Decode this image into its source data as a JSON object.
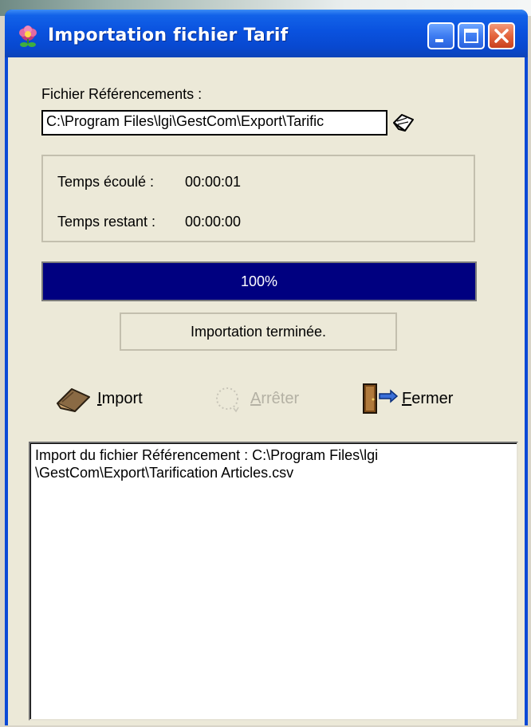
{
  "window": {
    "title": "Importation fichier Tarif"
  },
  "icons": {
    "app": "flower-icon",
    "browse": "folder-browse-icon",
    "import": "book-import-icon",
    "stop": "spinner-icon",
    "close": "door-exit-icon"
  },
  "file": {
    "label": "Fichier Référencements :",
    "value": "C:\\Program Files\\lgi\\GestCom\\Export\\Tarific"
  },
  "timing": {
    "elapsed_label": "Temps écoulé :",
    "elapsed_value": "00:00:01",
    "remaining_label": "Temps restant :",
    "remaining_value": "00:00:00"
  },
  "progress": {
    "percent": 100,
    "label": "100%"
  },
  "status": {
    "text": "Importation terminée."
  },
  "actions": {
    "import": {
      "mnemonic": "I",
      "rest": "mport"
    },
    "stop": {
      "mnemonic": "A",
      "rest": "rrêter"
    },
    "close": {
      "mnemonic": "F",
      "rest": "ermer"
    }
  },
  "log": {
    "text": "Import du fichier Référencement : C:\\Program Files\\lgi\n\\GestCom\\Export\\Tarification Articles.csv"
  },
  "colors": {
    "titlebar": "#0a52df",
    "progress_fill": "#000080",
    "window_bg": "#ece9d8"
  }
}
